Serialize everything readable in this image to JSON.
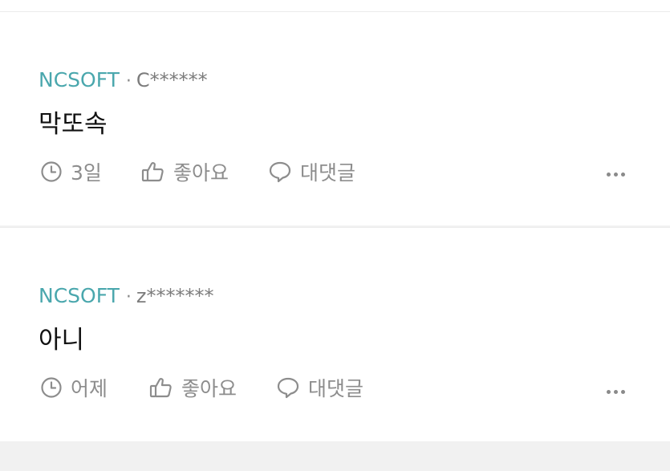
{
  "comments": [
    {
      "brand": "NCSOFT",
      "separator": "·",
      "user": "C******",
      "text": "막또속",
      "time": "3일",
      "like_label": "좋아요",
      "reply_label": "대댓글"
    },
    {
      "brand": "NCSOFT",
      "separator": "·",
      "user": "z*******",
      "text": "아니",
      "time": "어제",
      "like_label": "좋아요",
      "reply_label": "대댓글"
    }
  ],
  "colors": {
    "brand": "#4aa7ad",
    "meta_gray": "#8d8d8d",
    "text": "#111111",
    "divider": "#ececec"
  },
  "icons": [
    "clock-icon",
    "thumbs-up-icon",
    "speech-bubble-icon",
    "more-options-icon"
  ]
}
